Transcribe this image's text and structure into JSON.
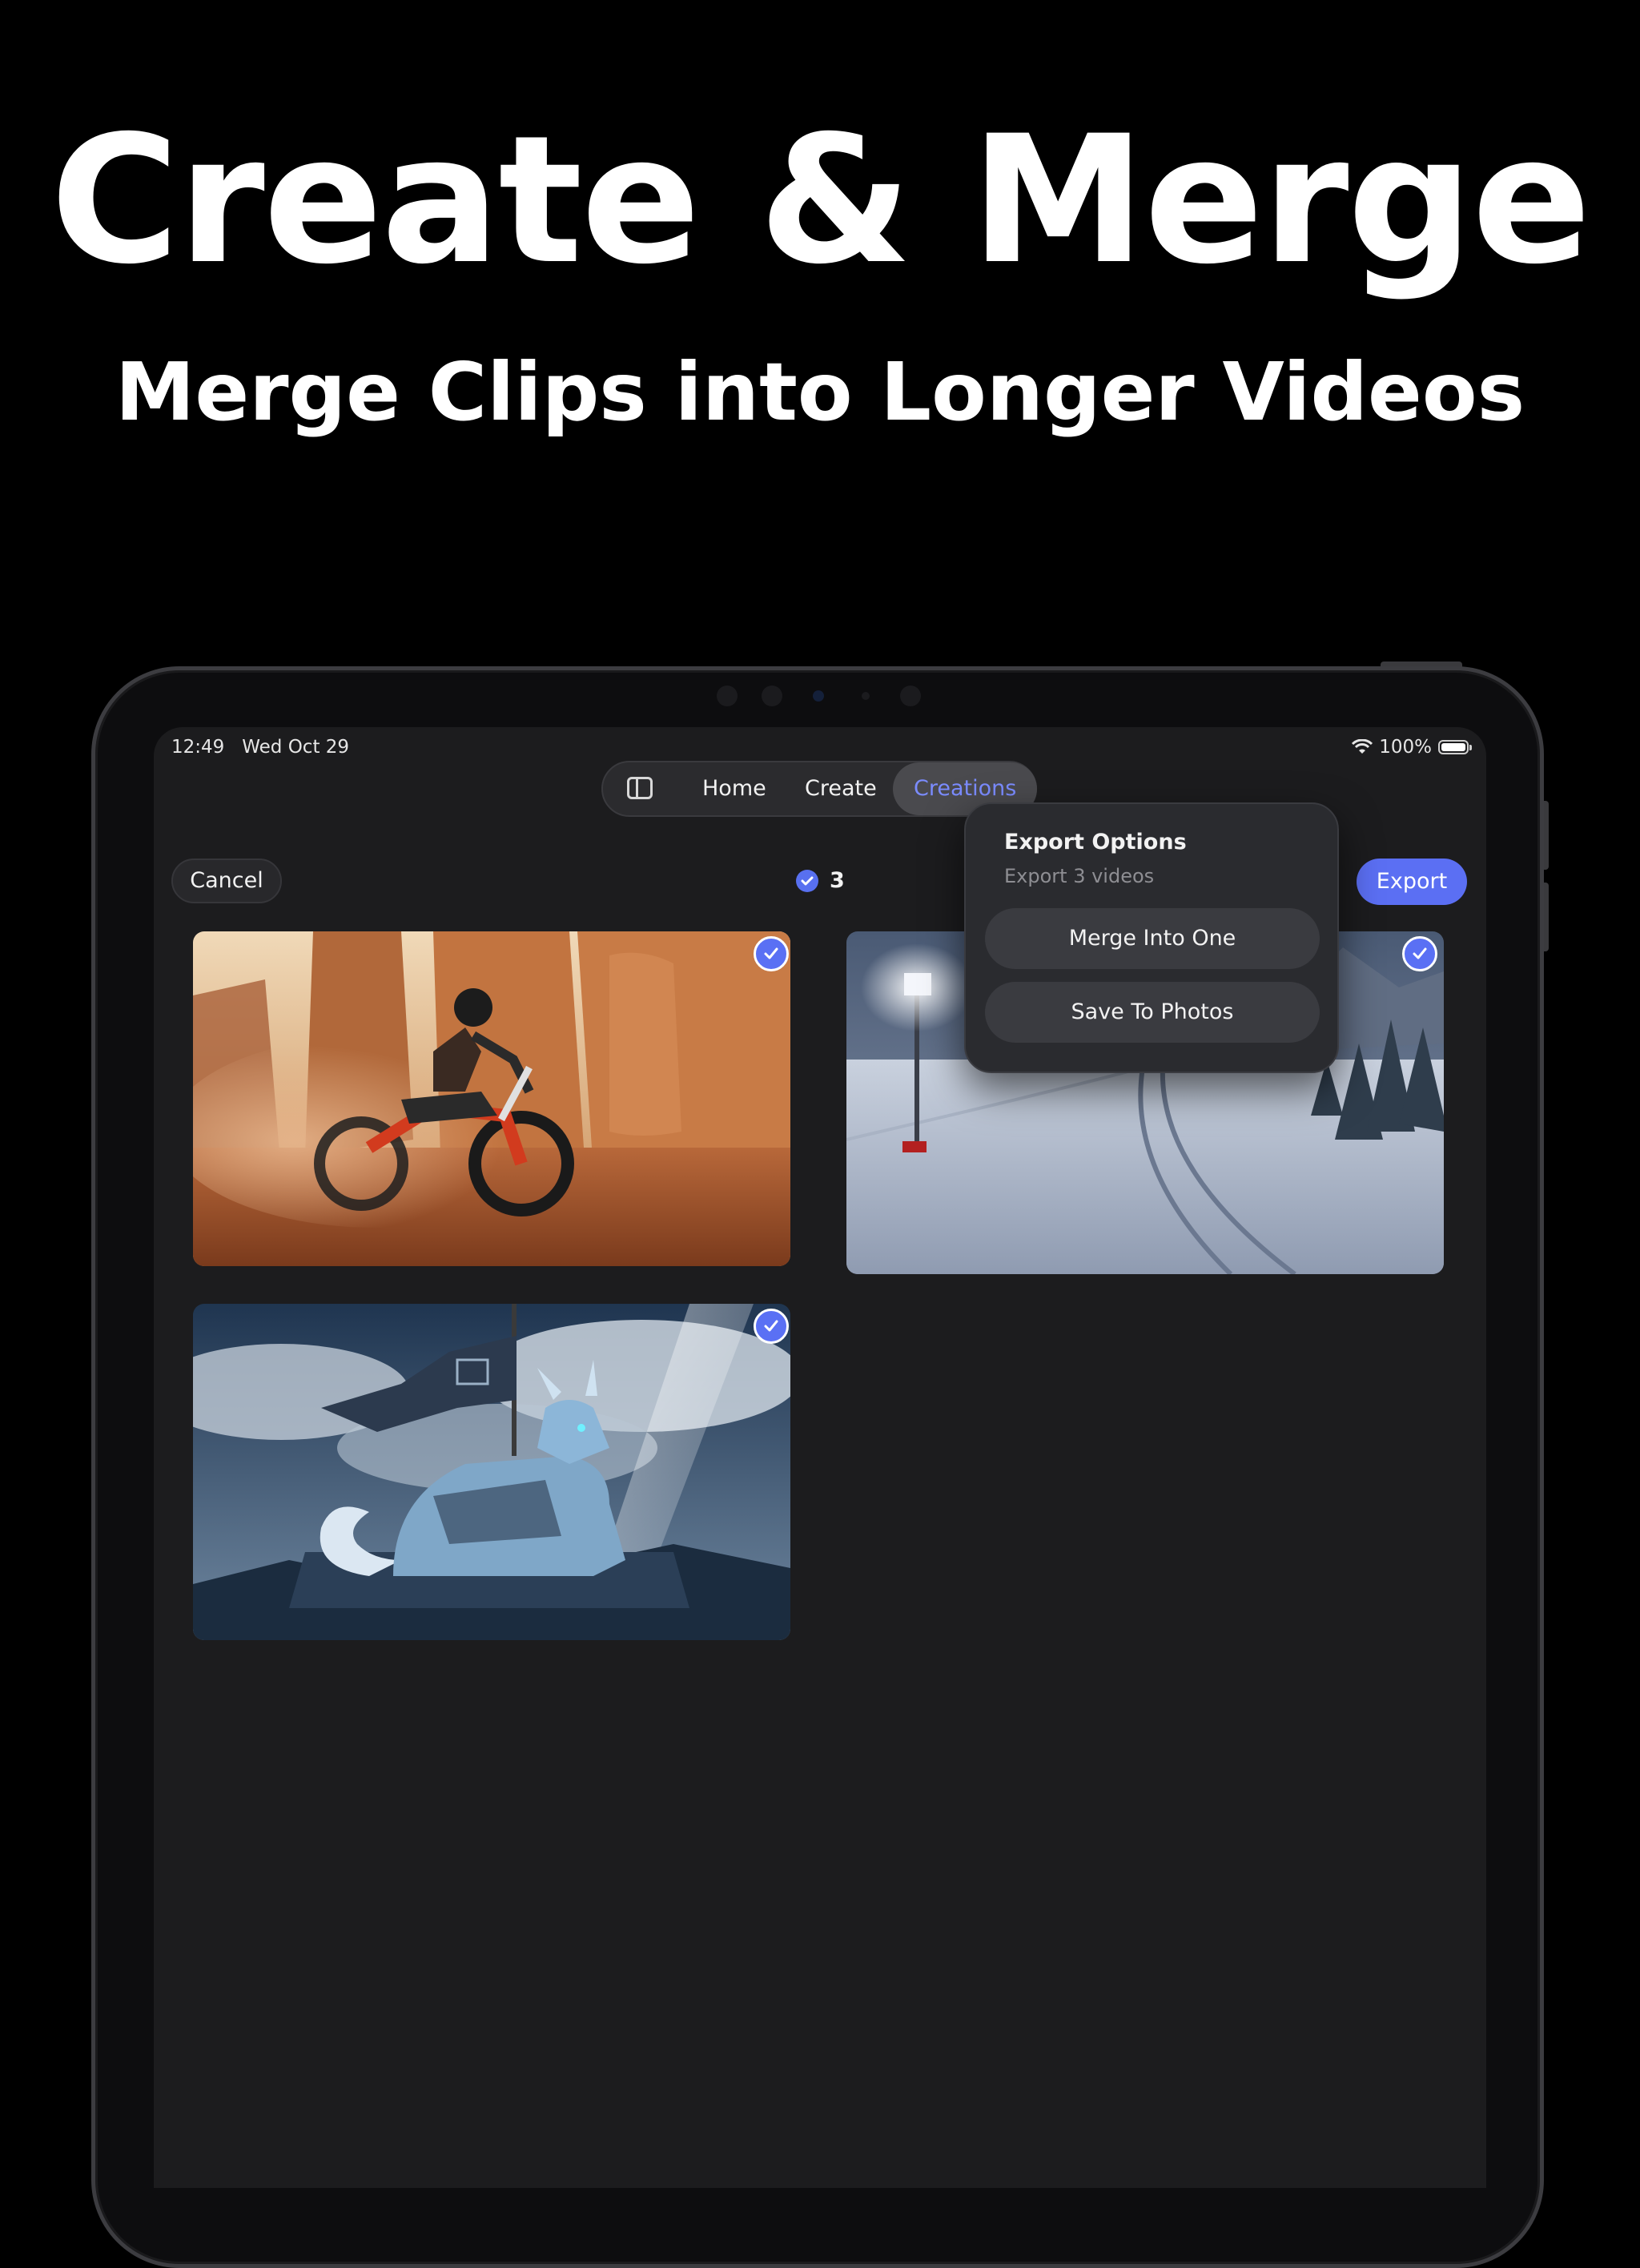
{
  "headline": "Create & Merge",
  "subheadline": "Merge Clips into Longer Videos",
  "status_bar": {
    "time": "12:49",
    "date": "Wed Oct 29",
    "battery": "100%",
    "battery_level": 1.0
  },
  "nav": {
    "sidebar_icon": "sidebar-icon",
    "tabs": [
      {
        "label": "Home",
        "active": false
      },
      {
        "label": "Create",
        "active": false
      },
      {
        "label": "Creations",
        "active": true
      }
    ]
  },
  "toolbar": {
    "cancel_label": "Cancel",
    "selected_count": "3",
    "export_label": "Export"
  },
  "popover": {
    "title": "Export Options",
    "subtitle": "Export 3 videos",
    "options": [
      "Merge Into One",
      "Save To Photos"
    ]
  },
  "thumbnails": [
    {
      "subject": "motocross rider in desert canyon",
      "selected": true
    },
    {
      "subject": "snowy night track with floodlights",
      "selected": true
    },
    {
      "subject": "armored ice dragon with banner",
      "selected": true
    }
  ],
  "colors": {
    "accent": "#5b6ff3",
    "active_tab_text": "#7b8cff",
    "screen_bg": "#1c1c1e",
    "page_bg": "#000000"
  }
}
